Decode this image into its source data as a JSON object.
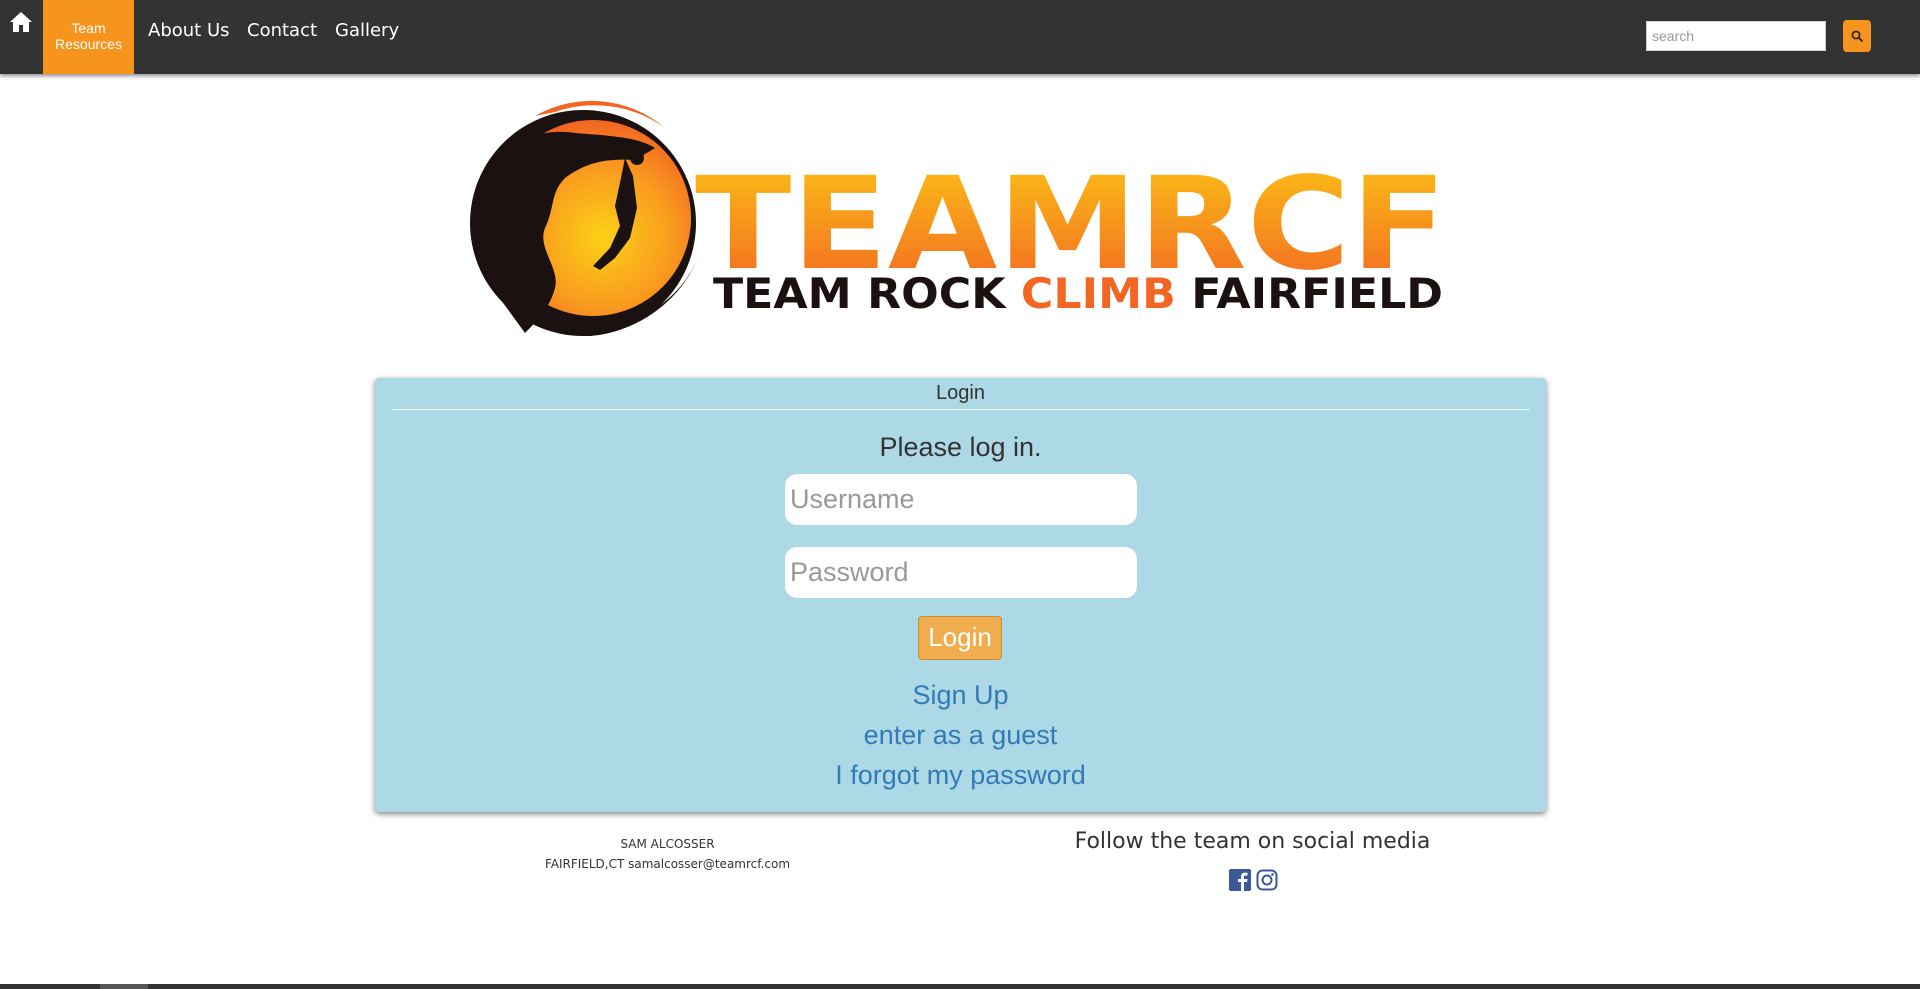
{
  "navbar": {
    "home_icon": "home-icon",
    "team_resources_label": "Team Resources",
    "about_label": "About Us",
    "contact_label": "Contact",
    "gallery_label": "Gallery",
    "search_placeholder": "search",
    "search_icon": "search-icon"
  },
  "logo": {
    "wordmark": "TEAMRCF",
    "tagline_part1": "TEAM ROCK ",
    "tagline_part2": "CLIMB",
    "tagline_part3": " FAIRFIELD"
  },
  "login_panel": {
    "title": "Login",
    "prompt": "Please log in.",
    "username_placeholder": "Username",
    "password_placeholder": "Password",
    "login_button": "Login",
    "signup_link": "Sign Up",
    "guest_link": "enter as a guest",
    "forgot_link": "I forgot my password"
  },
  "footer": {
    "name": "SAM ALCOSSER",
    "address_email": "FAIRFIELD,CT samalcosser@teamrcf.com",
    "social_title": "Follow the team on social media",
    "social_icons": [
      "facebook-icon",
      "instagram-icon"
    ]
  },
  "colors": {
    "navbar_bg": "#333333",
    "accent_orange": "#f7941d",
    "panel_bg": "#add8e6",
    "login_button": "#f0ad4e",
    "link_blue": "#337ab7",
    "facebook_blue": "#3b5998"
  }
}
